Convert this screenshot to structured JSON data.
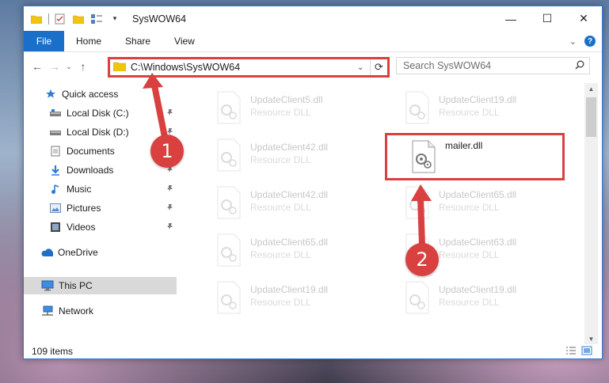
{
  "window": {
    "title": "SysWOW64",
    "controls": {
      "minimize": "—",
      "maximize": "☐",
      "close": "✕"
    }
  },
  "ribbon": {
    "file_tab": "File",
    "tabs": [
      "Home",
      "Share",
      "View"
    ]
  },
  "nav": {
    "address_path": "C:\\Windows\\SysWOW64",
    "search_placeholder": "Search SysWOW64"
  },
  "sidebar": {
    "items": [
      {
        "label": "Quick access",
        "icon": "star-icon",
        "pinned": false
      },
      {
        "label": "Local Disk (C:)",
        "icon": "drive-icon",
        "pinned": true
      },
      {
        "label": "Local Disk (D:)",
        "icon": "drive-icon",
        "pinned": true
      },
      {
        "label": "Documents",
        "icon": "documents-icon",
        "pinned": true
      },
      {
        "label": "Downloads",
        "icon": "download-icon",
        "pinned": true
      },
      {
        "label": "Music",
        "icon": "music-icon",
        "pinned": true
      },
      {
        "label": "Pictures",
        "icon": "pictures-icon",
        "pinned": true
      },
      {
        "label": "Videos",
        "icon": "videos-icon",
        "pinned": true
      },
      {
        "label": "OneDrive",
        "icon": "cloud-icon",
        "pinned": false
      },
      {
        "label": "This PC",
        "icon": "computer-icon",
        "pinned": false,
        "selected": true
      },
      {
        "label": "Network",
        "icon": "network-icon",
        "pinned": false
      }
    ]
  },
  "files": [
    {
      "name": "UpdateClient5.dll",
      "type": "Resource DLL"
    },
    {
      "name": "UpdateClient19.dll",
      "type": "Resource DLL"
    },
    {
      "name": "UpdateClient42.dll",
      "type": "Resource DLL"
    },
    {
      "name": "mailer.dll",
      "type": ""
    },
    {
      "name": "UpdateClient42.dll",
      "type": "Resource DLL"
    },
    {
      "name": "UpdateClient65.dll",
      "type": "Resource DLL"
    },
    {
      "name": "UpdateClient65.dll",
      "type": "Resource DLL"
    },
    {
      "name": "UpdateClient63.dll",
      "type": "Resource DLL"
    },
    {
      "name": "UpdateClient19.dll",
      "type": "Resource DLL"
    },
    {
      "name": "UpdateClient19.dll",
      "type": "Resource DLL"
    }
  ],
  "status": {
    "item_count": "109 items"
  },
  "annotations": {
    "step1": "1",
    "step2": "2"
  },
  "colors": {
    "accent": "#1a6fc9",
    "highlight": "#d94040"
  }
}
